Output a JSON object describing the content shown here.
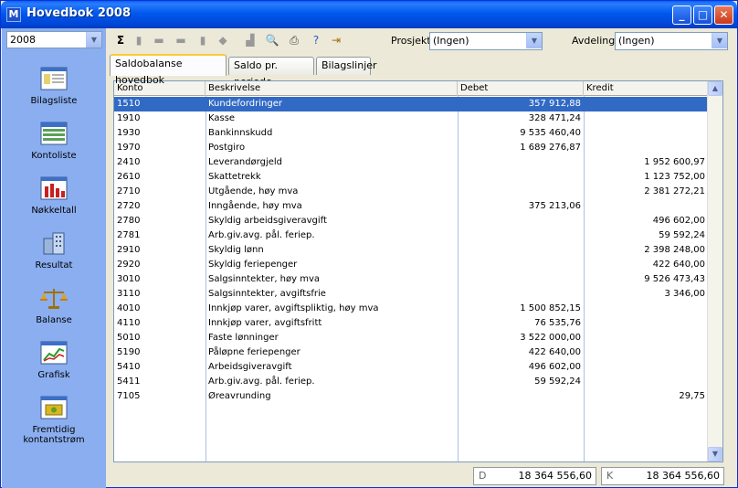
{
  "window": {
    "title": "Hovedbok 2008",
    "icon": "M"
  },
  "sidebar": {
    "year": "2008",
    "items": [
      {
        "label": "Bilagsliste",
        "icon": "list-icon"
      },
      {
        "label": "Kontoliste",
        "icon": "table-icon"
      },
      {
        "label": "Nøkkeltall",
        "icon": "bar-chart-icon"
      },
      {
        "label": "Resultat",
        "icon": "buildings-icon"
      },
      {
        "label": "Balanse",
        "icon": "scales-icon"
      },
      {
        "label": "Grafisk",
        "icon": "line-chart-icon"
      },
      {
        "label": "Fremtidig kontantstrøm",
        "icon": "cashflow-icon"
      }
    ]
  },
  "toolbar": {
    "sum_symbol": "Σ",
    "prosjekt_label": "Prosjekt",
    "prosjekt_value": "(Ingen)",
    "avdeling_label": "Avdeling",
    "avdeling_value": "(Ingen)"
  },
  "tabs": [
    "Saldobalanse hovedbok",
    "Saldo pr. periode",
    "Bilagslinjer"
  ],
  "grid": {
    "headers": [
      "Konto",
      "Beskrivelse",
      "Debet",
      "Kredit"
    ],
    "rows": [
      [
        "1510",
        "Kundefordringer",
        "357 912,88",
        ""
      ],
      [
        "1910",
        "Kasse",
        "328 471,24",
        ""
      ],
      [
        "1930",
        "Bankinnskudd",
        "9 535 460,40",
        ""
      ],
      [
        "1970",
        "Postgiro",
        "1 689 276,87",
        ""
      ],
      [
        "2410",
        "Leverandørgjeld",
        "",
        "1 952 600,97"
      ],
      [
        "2610",
        "Skattetrekk",
        "",
        "1 123 752,00"
      ],
      [
        "2710",
        "Utgående, høy mva",
        "",
        "2 381 272,21"
      ],
      [
        "2720",
        "Inngående, høy mva",
        "375 213,06",
        ""
      ],
      [
        "2780",
        "Skyldig arbeidsgiveravgift",
        "",
        "496 602,00"
      ],
      [
        "2781",
        "Arb.giv.avg. pål. feriep.",
        "",
        "59 592,24"
      ],
      [
        "2910",
        "Skyldig lønn",
        "",
        "2 398 248,00"
      ],
      [
        "2920",
        "Skyldig feriepenger",
        "",
        "422 640,00"
      ],
      [
        "3010",
        "Salgsinntekter, høy mva",
        "",
        "9 526 473,43"
      ],
      [
        "3110",
        "Salgsinntekter, avgiftsfrie",
        "",
        "3 346,00"
      ],
      [
        "4010",
        "Innkjøp varer, avgiftspliktig, høy mva",
        "1 500 852,15",
        ""
      ],
      [
        "4110",
        "Innkjøp varer, avgiftsfritt",
        "76 535,76",
        ""
      ],
      [
        "5010",
        "Faste lønninger",
        "3 522 000,00",
        ""
      ],
      [
        "5190",
        "Påløpne feriepenger",
        "422 640,00",
        ""
      ],
      [
        "5410",
        "Arbeidsgiveravgift",
        "496 602,00",
        ""
      ],
      [
        "5411",
        "Arb.giv.avg. pål. feriep.",
        "59 592,24",
        ""
      ],
      [
        "7105",
        "Øreavrunding",
        "",
        "29,75"
      ]
    ]
  },
  "totals": {
    "debet_label": "D",
    "debet": "18 364 556,60",
    "kredit_label": "K",
    "kredit": "18 364 556,60"
  }
}
